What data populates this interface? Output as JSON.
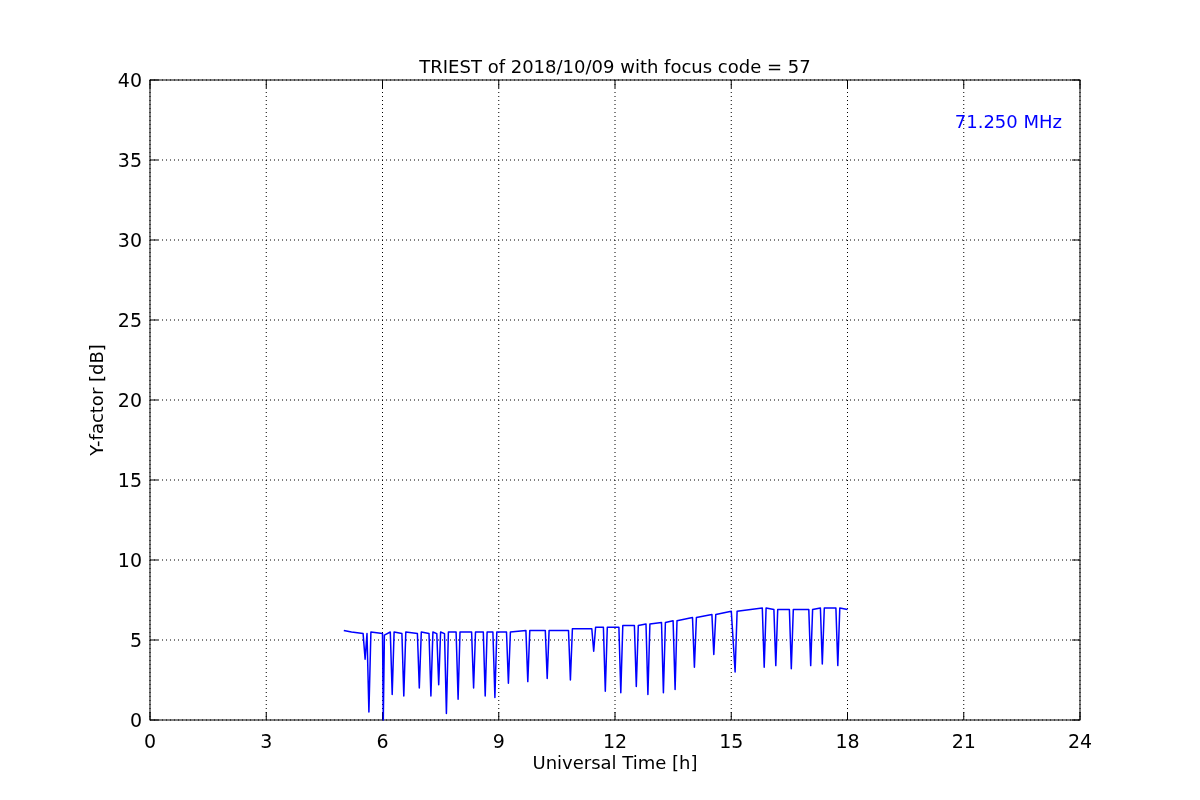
{
  "figure": {
    "chart_data": {
      "type": "line",
      "title": "TRIEST of 2018/10/09 with focus code = 57",
      "xlabel": "Universal Time [h]",
      "ylabel": "Y-factor [dB]",
      "xlim": [
        0,
        24
      ],
      "ylim": [
        0,
        40
      ],
      "xticks": [
        0,
        3,
        6,
        9,
        12,
        15,
        18,
        21,
        24
      ],
      "yticks": [
        0,
        5,
        10,
        15,
        20,
        25,
        30,
        35,
        40
      ],
      "x": [
        5.0,
        5.2,
        5.5,
        5.55,
        5.6,
        5.65,
        5.7,
        6.0,
        6.02,
        6.05,
        6.2,
        6.25,
        6.3,
        6.5,
        6.55,
        6.6,
        6.9,
        6.95,
        7.0,
        7.2,
        7.25,
        7.3,
        7.4,
        7.45,
        7.5,
        7.6,
        7.65,
        7.7,
        7.9,
        7.95,
        8.0,
        8.3,
        8.35,
        8.4,
        8.6,
        8.65,
        8.7,
        8.85,
        8.9,
        8.95,
        9.2,
        9.25,
        9.3,
        9.7,
        9.75,
        9.8,
        10.2,
        10.25,
        10.3,
        10.8,
        10.85,
        10.9,
        11.4,
        11.45,
        11.5,
        11.7,
        11.75,
        11.8,
        12.1,
        12.15,
        12.2,
        12.5,
        12.55,
        12.6,
        12.8,
        12.85,
        12.9,
        13.2,
        13.25,
        13.3,
        13.5,
        13.55,
        13.6,
        14.0,
        14.05,
        14.1,
        14.5,
        14.55,
        14.6,
        15.0,
        15.1,
        15.15,
        15.8,
        15.85,
        15.9,
        16.1,
        16.15,
        16.2,
        16.5,
        16.55,
        16.6,
        17.0,
        17.05,
        17.1,
        17.3,
        17.35,
        17.4,
        17.7,
        17.75,
        17.8,
        18.0
      ],
      "series": [
        {
          "name": "71.250 MHz",
          "color": "#0000ff",
          "values": [
            5.6,
            5.5,
            5.4,
            3.8,
            5.4,
            0.5,
            5.5,
            5.4,
            0.0,
            5.3,
            5.5,
            1.6,
            5.5,
            5.4,
            1.5,
            5.5,
            5.4,
            2.0,
            5.5,
            5.4,
            1.5,
            5.5,
            5.4,
            2.2,
            5.5,
            5.4,
            0.4,
            5.5,
            5.5,
            1.3,
            5.5,
            5.5,
            2.0,
            5.5,
            5.5,
            1.5,
            5.5,
            5.5,
            1.4,
            5.5,
            5.5,
            2.3,
            5.5,
            5.6,
            2.4,
            5.6,
            5.6,
            2.6,
            5.6,
            5.6,
            2.5,
            5.7,
            5.7,
            4.3,
            5.8,
            5.8,
            1.8,
            5.8,
            5.8,
            1.7,
            5.9,
            5.9,
            2.1,
            5.9,
            6.0,
            1.6,
            6.0,
            6.1,
            1.7,
            6.1,
            6.2,
            1.9,
            6.2,
            6.4,
            3.3,
            6.4,
            6.6,
            4.1,
            6.6,
            6.8,
            3.0,
            6.8,
            7.0,
            3.3,
            7.0,
            6.9,
            3.4,
            6.9,
            6.9,
            3.2,
            6.9,
            6.9,
            3.4,
            6.9,
            7.0,
            3.5,
            7.0,
            7.0,
            3.4,
            7.0,
            6.9
          ]
        }
      ],
      "grid": true
    }
  }
}
